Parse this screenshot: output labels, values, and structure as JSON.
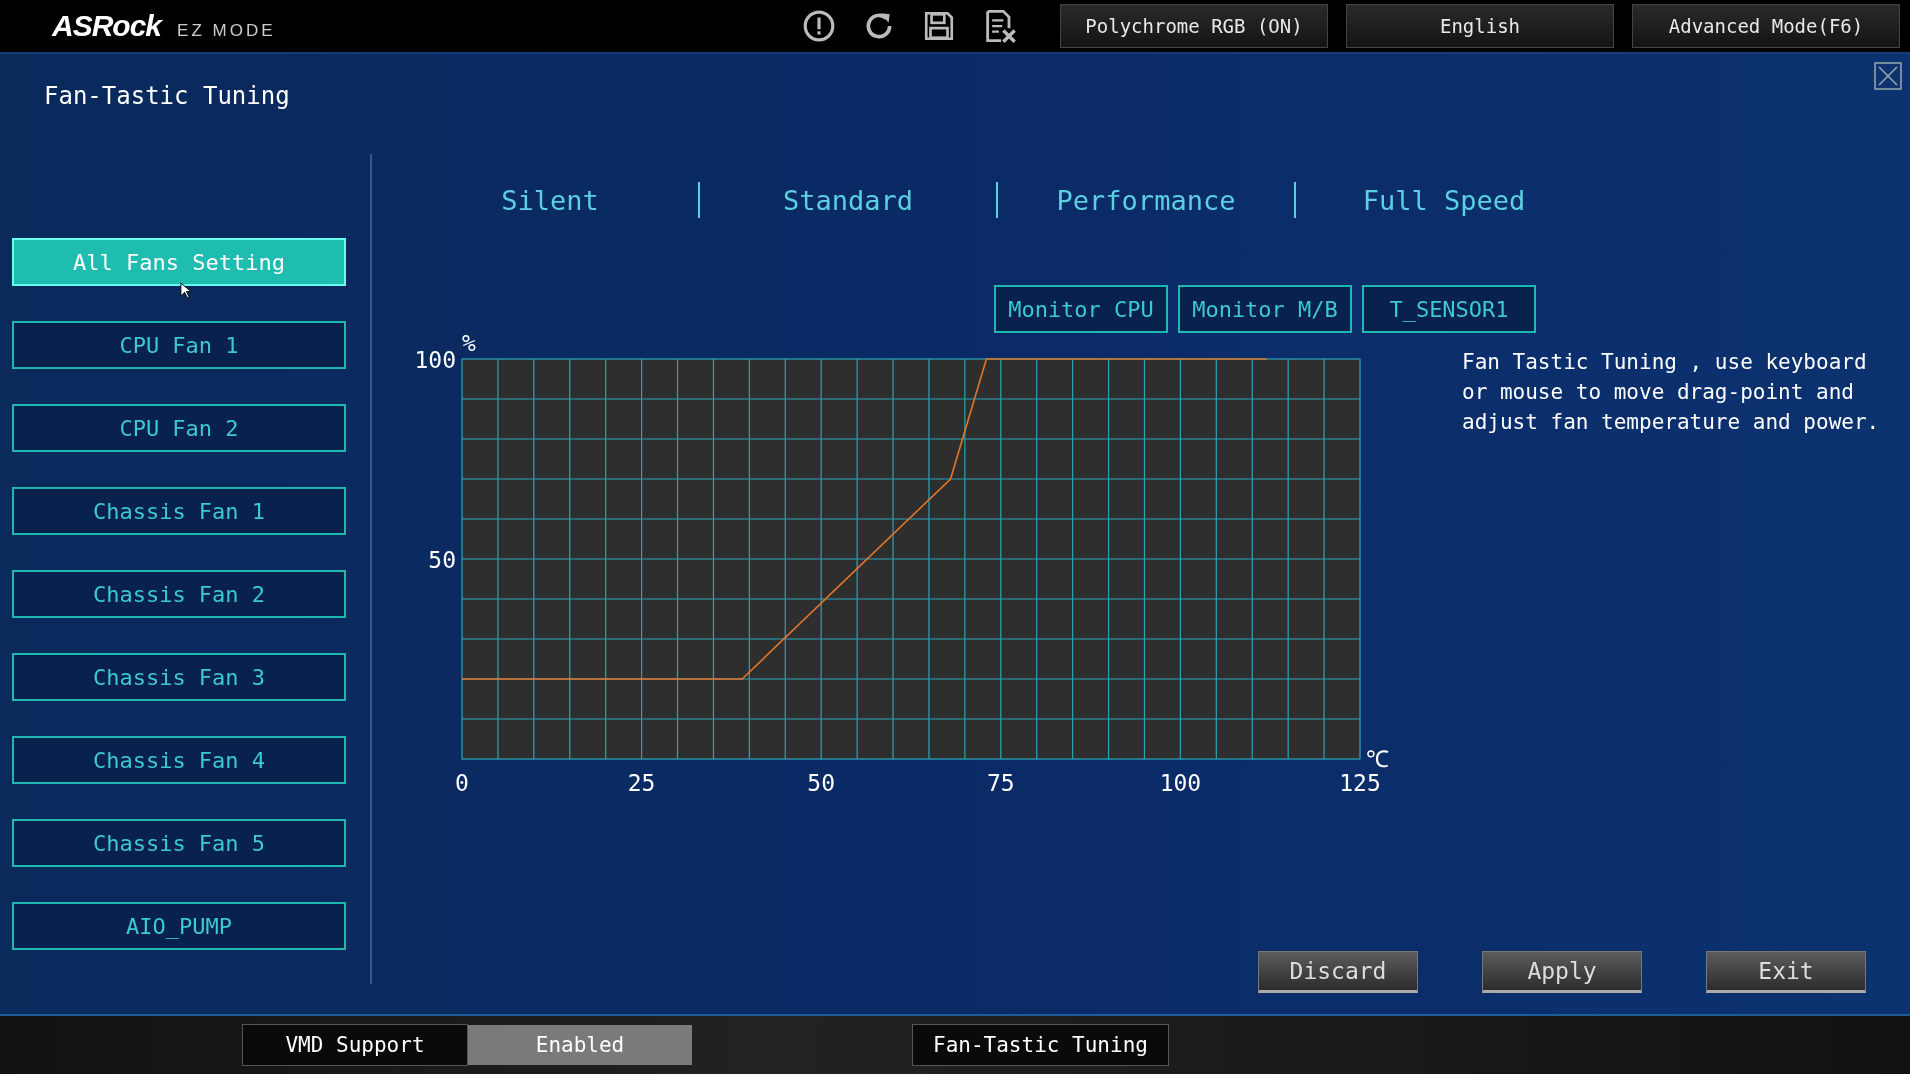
{
  "header": {
    "logo": "ASRock",
    "mode": "EZ MODE",
    "buttons": [
      "Polychrome RGB (ON)",
      "English",
      "Advanced Mode(F6)"
    ]
  },
  "panel": {
    "title": "Fan-Tastic Tuning",
    "fans": [
      {
        "label": "All Fans Setting",
        "selected": true
      },
      {
        "label": "CPU Fan 1",
        "selected": false
      },
      {
        "label": "CPU Fan 2",
        "selected": false
      },
      {
        "label": "Chassis Fan 1",
        "selected": false
      },
      {
        "label": "Chassis Fan 2",
        "selected": false
      },
      {
        "label": "Chassis Fan 3",
        "selected": false
      },
      {
        "label": "Chassis Fan 4",
        "selected": false
      },
      {
        "label": "Chassis Fan 5",
        "selected": false
      },
      {
        "label": "AIO_PUMP",
        "selected": false
      }
    ],
    "presets": [
      "Silent",
      "Standard",
      "Performance",
      "Full Speed"
    ],
    "sensors": [
      "Monitor CPU",
      "Monitor M/B",
      "T_SENSOR1"
    ],
    "chart_data": {
      "type": "line",
      "ylabel": "%",
      "xlabel": "℃",
      "x": [
        0,
        39,
        68,
        73,
        112
      ],
      "series": [
        {
          "color": "#e0762a",
          "values": [
            20,
            20,
            70,
            100,
            100
          ]
        }
      ],
      "grid": true,
      "xlim": [
        0,
        125
      ],
      "ylim": [
        0,
        100
      ],
      "xticks": [
        0,
        25,
        50,
        75,
        100,
        125
      ],
      "yticks": [
        50,
        100
      ]
    },
    "description": "Fan Tastic Tuning , use keyboard or mouse to move drag-point and adjust fan temperature and power.",
    "actions": [
      "Discard",
      "Apply",
      "Exit"
    ]
  },
  "background": {
    "items": [
      {
        "kind": "label",
        "text": "VMD Support"
      },
      {
        "kind": "value",
        "text": "Enabled"
      },
      {
        "kind": "label",
        "text": "Fan-Tastic Tuning"
      }
    ]
  }
}
